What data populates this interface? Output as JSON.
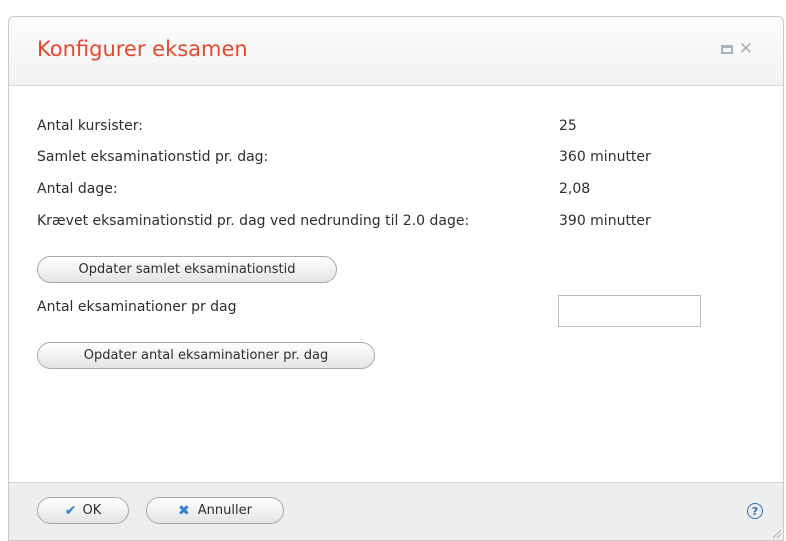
{
  "dialog": {
    "title": "Konfigurer eksamen",
    "icons": {
      "maximize": "maximize-icon",
      "close": "close-icon"
    }
  },
  "fields": [
    {
      "label": "Antal kursister:",
      "value": "25"
    },
    {
      "label": "Samlet eksaminationstid pr. dag:",
      "value": "360 minutter"
    },
    {
      "label": "Antal dage:",
      "value": "2,08"
    },
    {
      "label": "Krævet eksaminationstid pr. dag ved nedrunding til 2.0 dage:",
      "value": "390 minutter"
    }
  ],
  "buttons": {
    "update_total_time": "Opdater samlet eksaminationstid",
    "update_exams_per_day": "Opdater antal eksaminationer pr. dag"
  },
  "exams_per_day": {
    "label": "Antal eksaminationer pr dag",
    "value": "",
    "placeholder": ""
  },
  "footer": {
    "ok_label": "OK",
    "cancel_label": "Annuller",
    "help_glyph": "?"
  },
  "colors": {
    "title": "#e5482b",
    "accent": "#2f7fd6"
  }
}
